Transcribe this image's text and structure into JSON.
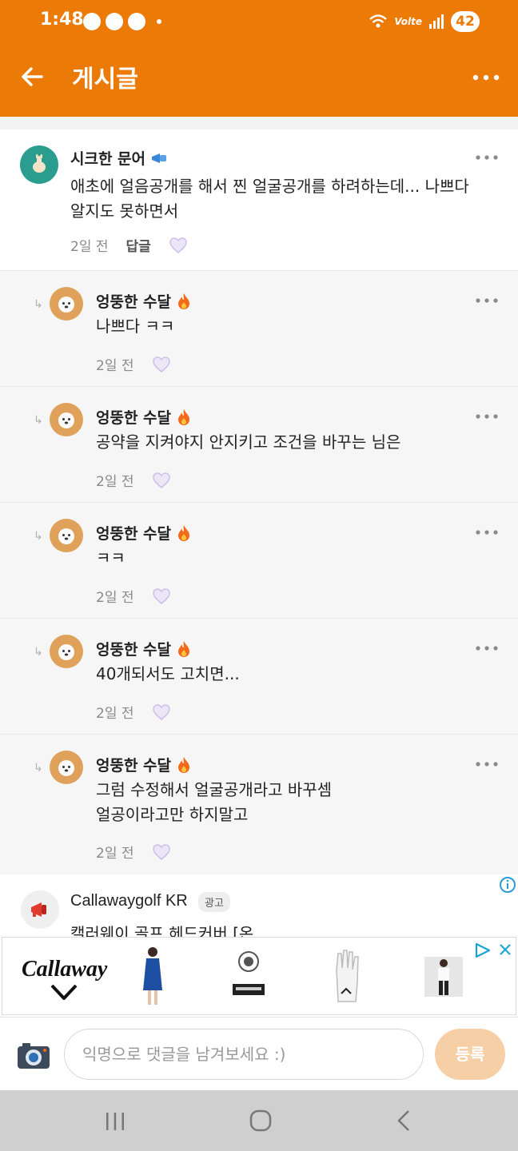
{
  "status_bar": {
    "time": "1:48",
    "network": "Volte",
    "battery": "42"
  },
  "app_bar": {
    "title": "게시글"
  },
  "comment": {
    "author": "시크한 문어",
    "text_lines": [
      "애초에 얼음공개를 해서 찐 얼굴공개를 하려하는데... 나쁘다",
      "알지도 못하면서"
    ],
    "time": "2일 전",
    "reply_label": "답글",
    "avatar_color": "#2a9d8f"
  },
  "replies": [
    {
      "author": "엉뚱한 수달",
      "text_lines": [
        "나쁘다 ㅋㅋ"
      ],
      "time": "2일 전"
    },
    {
      "author": "엉뚱한 수달",
      "text_lines": [
        "공약을 지켜야지 안지키고 조건을 바꾸는 님은"
      ],
      "time": "2일 전"
    },
    {
      "author": "엉뚱한 수달",
      "text_lines": [
        "ㅋㅋ"
      ],
      "time": "2일 전"
    },
    {
      "author": "엉뚱한 수달",
      "text_lines": [
        "40개되서도 고치면..."
      ],
      "time": "2일 전"
    },
    {
      "author": "엉뚱한 수달",
      "text_lines": [
        "그럼 수정해서 얼굴공개라고 바꾸셈",
        "얼공이라고만 하지말고"
      ],
      "time": "2일 전"
    }
  ],
  "ad": {
    "advertiser": "Callawaygolf KR",
    "badge": "광고",
    "text": "캘러웨이 골프 헤드커버 [온...",
    "brand": "Callaway"
  },
  "input_bar": {
    "placeholder": "익명으로 댓글을 남겨보세요 :)",
    "submit_label": "등록"
  },
  "colors": {
    "accent": "#ec7a07",
    "reply_avatar": "#e0a25a",
    "submit_button": "#f6cfa6"
  }
}
